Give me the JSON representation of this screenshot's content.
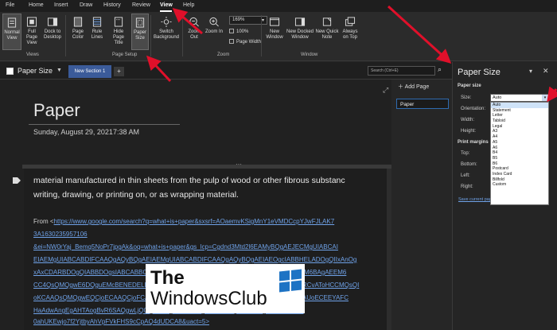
{
  "menu_tabs": [
    "File",
    "Home",
    "Insert",
    "Draw",
    "History",
    "Review",
    "View",
    "Help"
  ],
  "active_tab": "View",
  "ribbon": {
    "views": {
      "normal_view": "Normal View",
      "full_page_view": "Full Page View",
      "dock_to_desktop": "Dock to Desktop",
      "group": "Views"
    },
    "page_setup": {
      "page_color": "Page Color",
      "rule_lines": "Rule Lines",
      "hide_page_title": "Hide Page Title",
      "paper_size": "Paper Size",
      "group": "Page Setup"
    },
    "switch_background": "Switch Background",
    "zoom": {
      "zoom_out": "Zoom Out",
      "zoom_in": "Zoom In",
      "zoom_level": "169%",
      "pct100": "100%",
      "page_width": "Page Width",
      "group": "Zoom"
    },
    "window": {
      "new_window": "New Window",
      "new_docked_window": "New Docked Window",
      "new_quick_note": "New Quick Note",
      "always_on_top": "Always on Top",
      "group": "Window"
    }
  },
  "notebook": {
    "name": "Paper Size",
    "section_tab": "New Section 1",
    "add_tab": "+",
    "search_placeholder": "Search (Ctrl+E)"
  },
  "page": {
    "title": "Paper",
    "date": "Sunday, August 29, 2021",
    "time": "7:38 AM",
    "body_line1": "material manufactured in thin sheets from the pulp of wood or other fibrous substanc",
    "body_line2": "writing, drawing, or printing on, or as wrapping material.",
    "from_label": "From <",
    "link_lines": [
      "https://www.google.com/search?q=what+is+paper&sxsrf=AOaemvKSigMnY1eVMDCcpYJwFJLAK7",
      "3A1630235957106",
      "&ei=NW0rYaj_Bemq5NoPr7jpgAk&oq=what+is+paper&gs_lcp=Cgdnd3Mtd2l6EAMyBQgAEJECMgUIABCAI",
      "EIAEMgUIABCABDIFCAAQgAQyBQgAEIAEMgUIABCABDIFCAAQgAQyBQgAEIAEOgcIABBHELADOgQIIxAnOg",
      "xAxCDARBDOgQIABBDOgsIABCABBCxAxCDAToFCC4QgAQ6BAgAEA06CggAELEDEIMBEEM6BAgAEEM6",
      "CC4QsQMQgwE6DQguEMcBENEDELEDEEM6DQgAEIAEEIcCELEDEBQ6BAgAEAMSCDHARCvAToHCCMQsQI",
      "oKCAAQsQMQgwEQCjoECAAQCjoFCAAQsQM6BwgAELEDEAo6CAgAELEDEIMBOgUIIRCgAUoECEEYAFC",
      "HaAdwAngEgAHTAogBvR6SAQgwLjQ0LjEuMZgBAKABAcgBCMABAQ&sclient=gws-wiz&ved="
    ],
    "last_line": "0ahUKEwjo7f2YjtbyAhVpFVkFHS9cCpAQ4dUDCA8&uact=5>"
  },
  "watermark": {
    "line1": "The",
    "line2": "WindowsClub"
  },
  "page_list": {
    "add_page": "Add Page",
    "items": [
      "Paper"
    ]
  },
  "paper_size_pane": {
    "title": "Paper Size",
    "section_paper_size": "Paper size",
    "size_label": "Size:",
    "orientation_label": "Orientation:",
    "width_label": "Width:",
    "height_label": "Height:",
    "print_margins": "Print margins",
    "top_label": "Top:",
    "bottom_label": "Bottom:",
    "left_label": "Left:",
    "right_label": "Right:",
    "size_value": "Auto",
    "size_options": [
      "Auto",
      "Statement",
      "Letter",
      "Tabloid",
      "Legal",
      "A3",
      "A4",
      "A5",
      "A6",
      "B4",
      "B5",
      "B6",
      "Postcard",
      "Index Card",
      "Billfold",
      "Custom"
    ],
    "save_link": "Save current page as a template"
  },
  "colors": {
    "accent": "#2f6bb0",
    "annotation": "#e0102a",
    "link": "#6fa2e8"
  }
}
